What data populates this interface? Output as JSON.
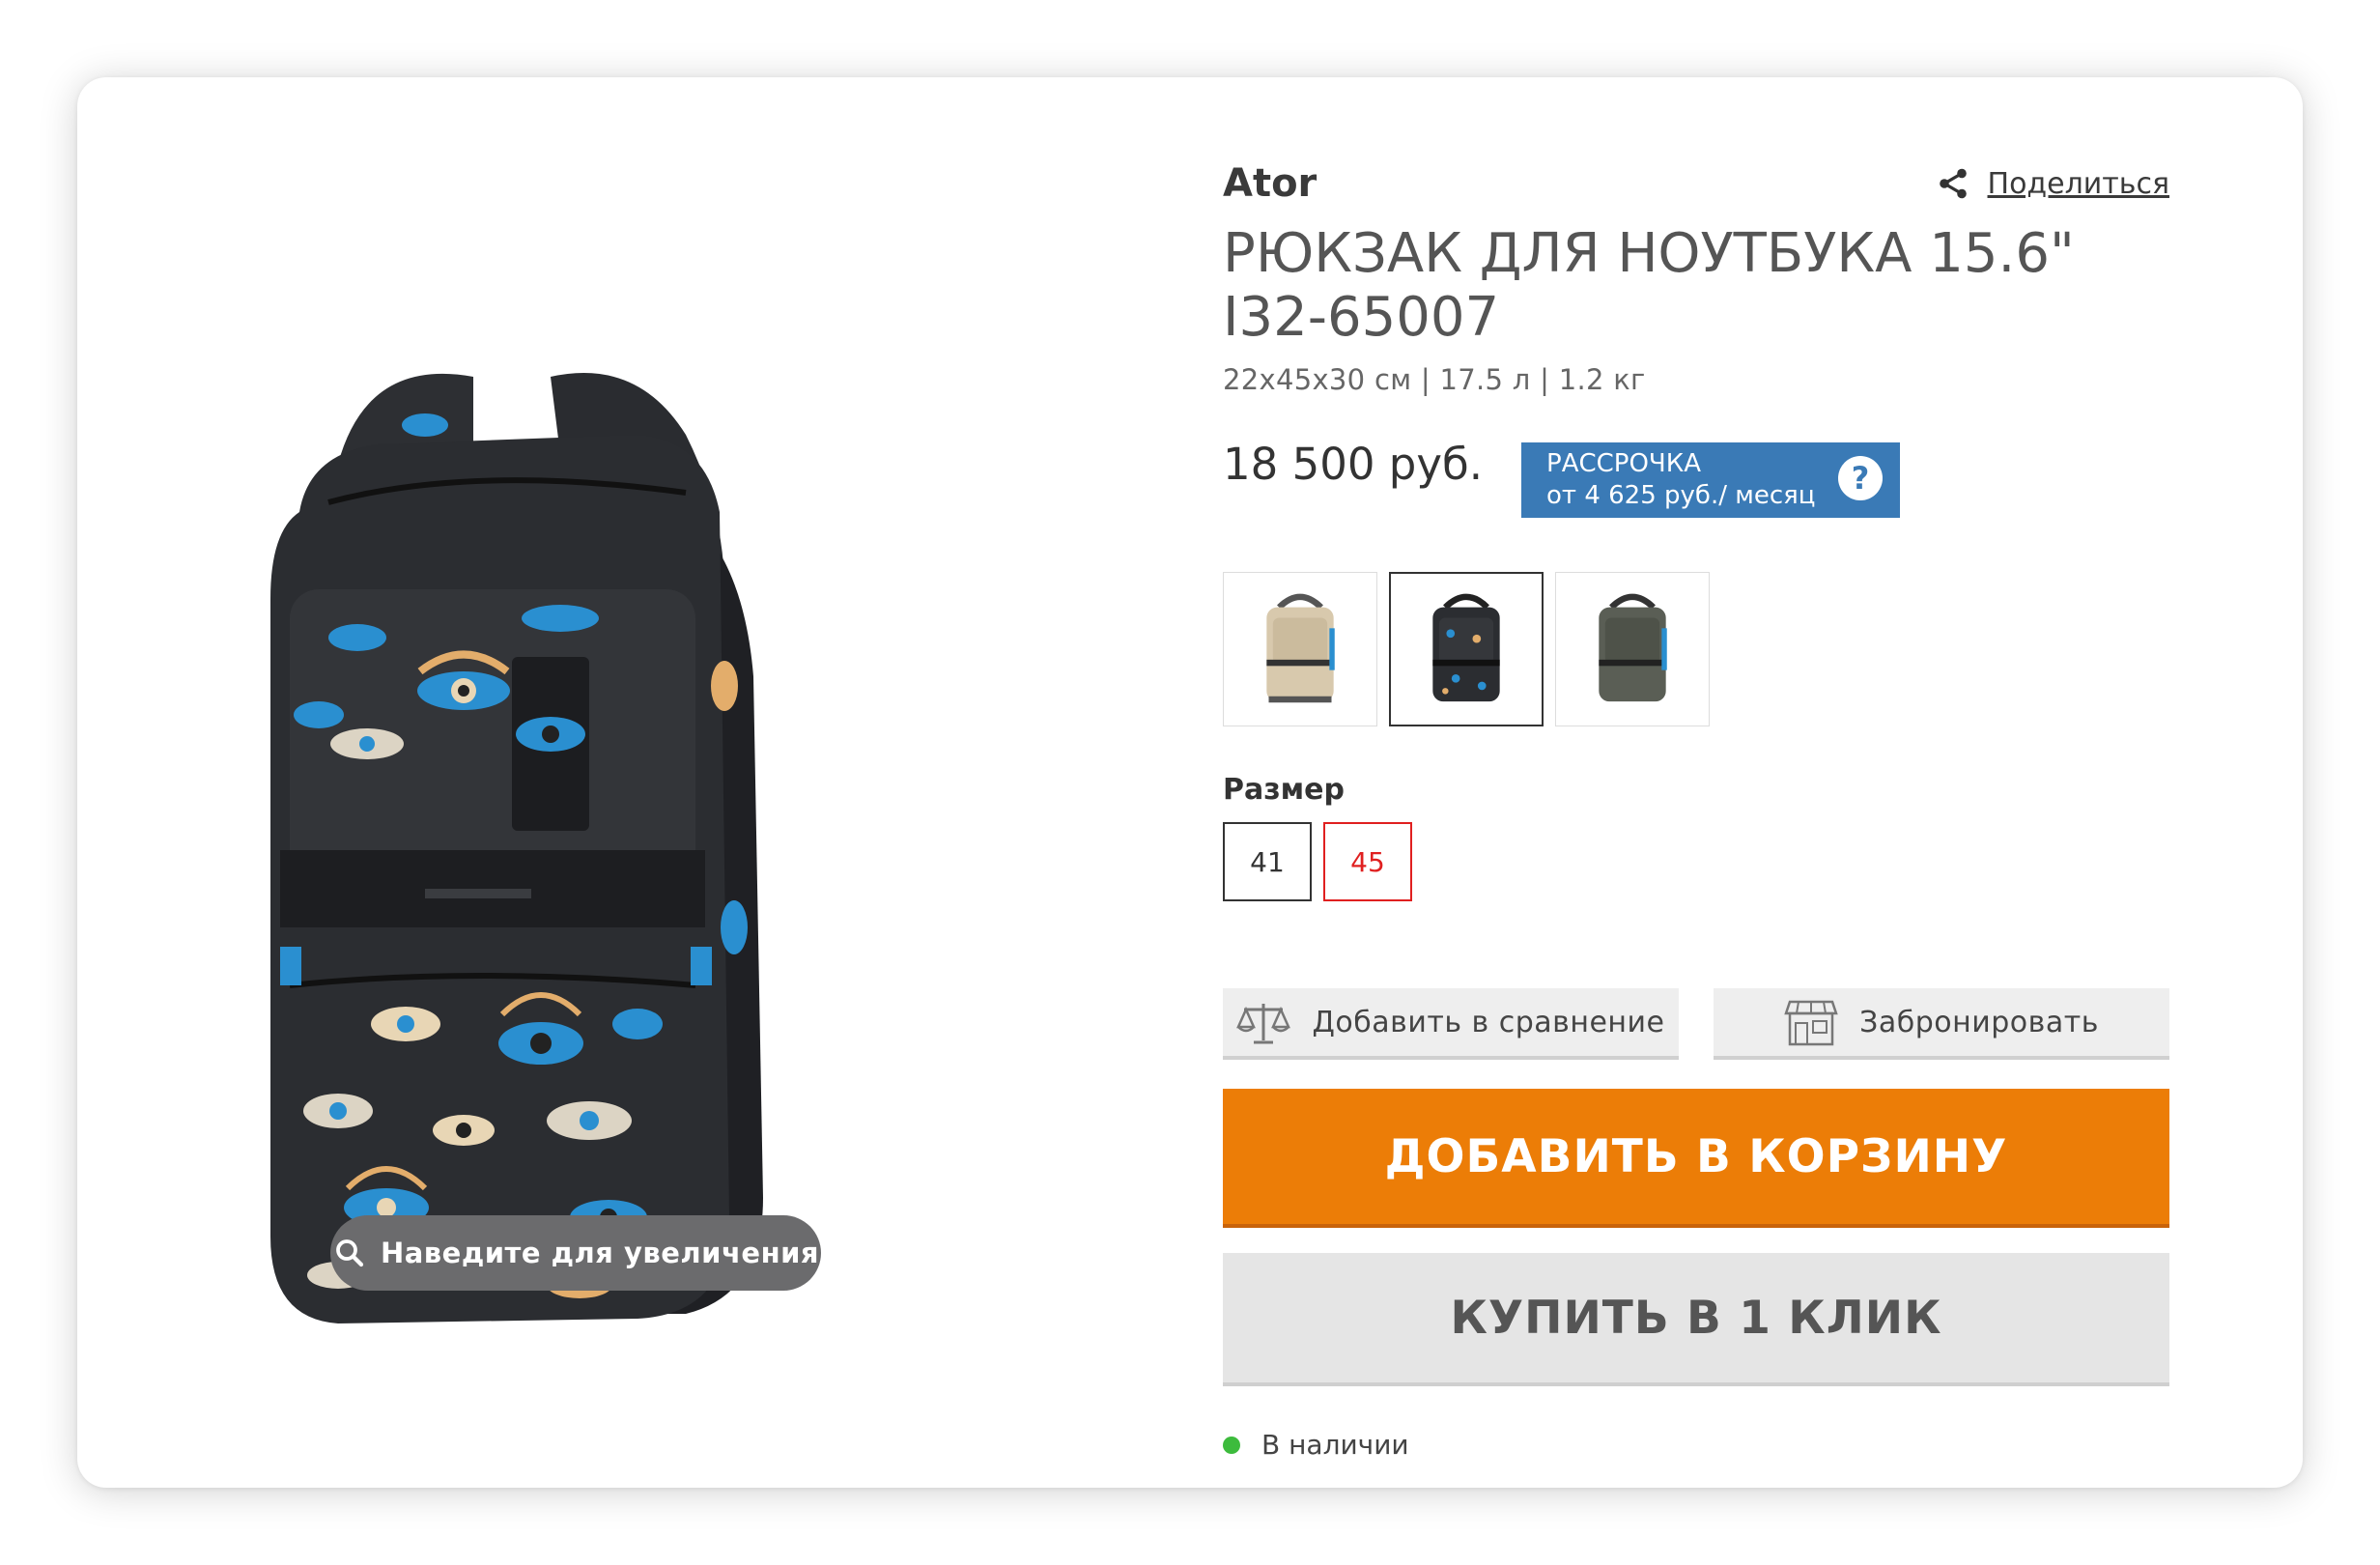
{
  "product": {
    "brand": "Ator",
    "title": "РЮКЗАК ДЛЯ НОУТБУКА 15.6\" I32-65007",
    "specs": "22x45x30 см | 17.5 л | 1.2 кг",
    "price": "18 500 руб."
  },
  "share": {
    "label": "Поделиться",
    "icon": "share-icon"
  },
  "installment": {
    "line1": "РАССРОЧКА",
    "line2": "от 4 625 руб./ месяц",
    "help": "?",
    "color": "#3a7ab6"
  },
  "image": {
    "zoom_hint": "Наведите для увеличения",
    "icon": "search-icon"
  },
  "swatches": [
    {
      "color": "beige",
      "active": false
    },
    {
      "color": "black-eyes",
      "active": true
    },
    {
      "color": "olive",
      "active": false
    }
  ],
  "size": {
    "label": "Размер",
    "options": [
      {
        "value": "41",
        "available": true
      },
      {
        "value": "45",
        "available": false
      }
    ]
  },
  "actions": {
    "compare": "Добавить в сравнение",
    "reserve": "Забронировать",
    "add_to_cart": "ДОБАВИТЬ В КОРЗИНУ",
    "one_click": "КУПИТЬ В 1 КЛИК"
  },
  "availability": {
    "text": "В наличии",
    "color": "#3dbb3d"
  },
  "colors": {
    "accent": "#ec7d07",
    "installment": "#3a7ab6",
    "unavailable": "#e02020"
  }
}
